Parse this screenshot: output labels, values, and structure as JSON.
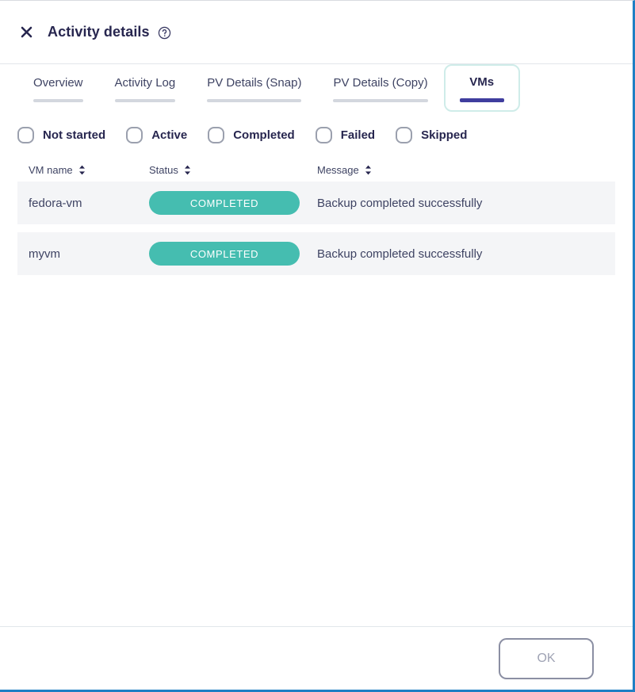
{
  "header": {
    "title": "Activity details",
    "close_icon": "close-icon",
    "help_icon": "help-circle-icon"
  },
  "tabs": [
    {
      "label": "Overview",
      "active": false
    },
    {
      "label": "Activity Log",
      "active": false
    },
    {
      "label": "PV Details (Snap)",
      "active": false
    },
    {
      "label": "PV Details (Copy)",
      "active": false
    },
    {
      "label": "VMs",
      "active": true
    }
  ],
  "filters": [
    {
      "label": "Not started",
      "checked": false
    },
    {
      "label": "Active",
      "checked": false
    },
    {
      "label": "Completed",
      "checked": false
    },
    {
      "label": "Failed",
      "checked": false
    },
    {
      "label": "Skipped",
      "checked": false
    }
  ],
  "table": {
    "columns": [
      {
        "label": "VM name",
        "sort_icon": "sort-icon"
      },
      {
        "label": "Status",
        "sort_icon": "sort-icon"
      },
      {
        "label": "Message",
        "sort_icon": "sort-icon"
      }
    ],
    "rows": [
      {
        "name": "fedora-vm",
        "status": "COMPLETED",
        "message": "Backup completed successfully"
      },
      {
        "name": "myvm",
        "status": "COMPLETED",
        "message": "Backup completed successfully"
      }
    ]
  },
  "footer": {
    "ok_label": "OK"
  },
  "colors": {
    "status_completed": "#45bdb0",
    "active_tab_underline": "#3f3d9e",
    "inactive_tab_underline": "#d3d7de",
    "focus_ring": "#cfece9",
    "window_accent": "#1f7fc4",
    "row_background": "#f4f5f7",
    "text_primary": "#27264f",
    "text_secondary": "#3e4363"
  }
}
